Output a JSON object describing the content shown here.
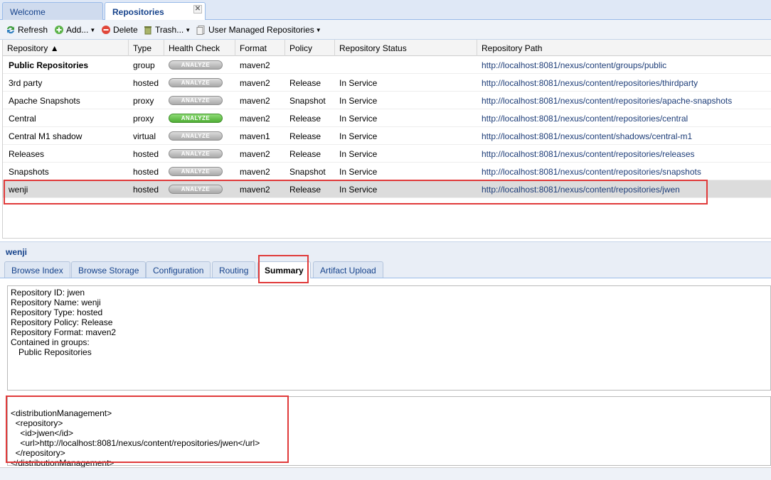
{
  "tabs": [
    {
      "label": "Welcome"
    },
    {
      "label": "Repositories",
      "close_glyph": "✕"
    }
  ],
  "toolbar": {
    "refresh": "Refresh",
    "add": "Add...",
    "delete": "Delete",
    "trash": "Trash...",
    "user_managed": "User Managed Repositories",
    "dropdown_glyph": "▼"
  },
  "grid": {
    "columns": [
      "Repository ▲",
      "Type",
      "Health Check",
      "Format",
      "Policy",
      "Repository Status",
      "Repository Path"
    ],
    "analyze_label": "ANALYZE",
    "rows": [
      {
        "name": "Public Repositories",
        "type": "group",
        "format": "maven2",
        "policy": "",
        "status": "",
        "path": "http://localhost:8081/nexus/content/groups/public"
      },
      {
        "name": "3rd party",
        "type": "hosted",
        "format": "maven2",
        "policy": "Release",
        "status": "In Service",
        "path": "http://localhost:8081/nexus/content/repositories/thirdparty"
      },
      {
        "name": "Apache Snapshots",
        "type": "proxy",
        "format": "maven2",
        "policy": "Snapshot",
        "status": "In Service",
        "path": "http://localhost:8081/nexus/content/repositories/apache-snapshots"
      },
      {
        "name": "Central",
        "type": "proxy",
        "format": "maven2",
        "policy": "Release",
        "status": "In Service",
        "path": "http://localhost:8081/nexus/content/repositories/central"
      },
      {
        "name": "Central M1 shadow",
        "type": "virtual",
        "format": "maven1",
        "policy": "Release",
        "status": "In Service",
        "path": "http://localhost:8081/nexus/content/shadows/central-m1"
      },
      {
        "name": "Releases",
        "type": "hosted",
        "format": "maven2",
        "policy": "Release",
        "status": "In Service",
        "path": "http://localhost:8081/nexus/content/repositories/releases"
      },
      {
        "name": "Snapshots",
        "type": "hosted",
        "format": "maven2",
        "policy": "Snapshot",
        "status": "In Service",
        "path": "http://localhost:8081/nexus/content/repositories/snapshots"
      },
      {
        "name": "wenji",
        "type": "hosted",
        "format": "maven2",
        "policy": "Release",
        "status": "In Service",
        "path": "http://localhost:8081/nexus/content/repositories/jwen"
      }
    ]
  },
  "detail": {
    "title": "wenji",
    "tabs": [
      "Browse Index",
      "Browse Storage",
      "Configuration",
      "Routing",
      "Summary",
      "Artifact Upload"
    ],
    "summary_lines": [
      "Repository ID: jwen",
      "Repository Name: wenji",
      "Repository Type: hosted",
      "Repository Policy: Release",
      "Repository Format: maven2",
      "Contained in groups:"
    ],
    "group_member": "Public Repositories",
    "xml_lines": [
      "<distributionManagement>",
      "  <repository>",
      "    <id>jwen</id>",
      "    <url>http://localhost:8081/nexus/content/repositories/jwen</url>",
      "  </repository>",
      "</distributionManagement>"
    ]
  },
  "colors": {
    "highlight": "#e03a3a",
    "link": "#1d3d78",
    "header_blue": "#15428b",
    "analyze_green": "#4fae35"
  },
  "icons": {
    "refresh": "refresh-icon",
    "add": "add-icon",
    "delete": "delete-icon",
    "trash": "trash-icon",
    "user_managed": "document-icon"
  }
}
